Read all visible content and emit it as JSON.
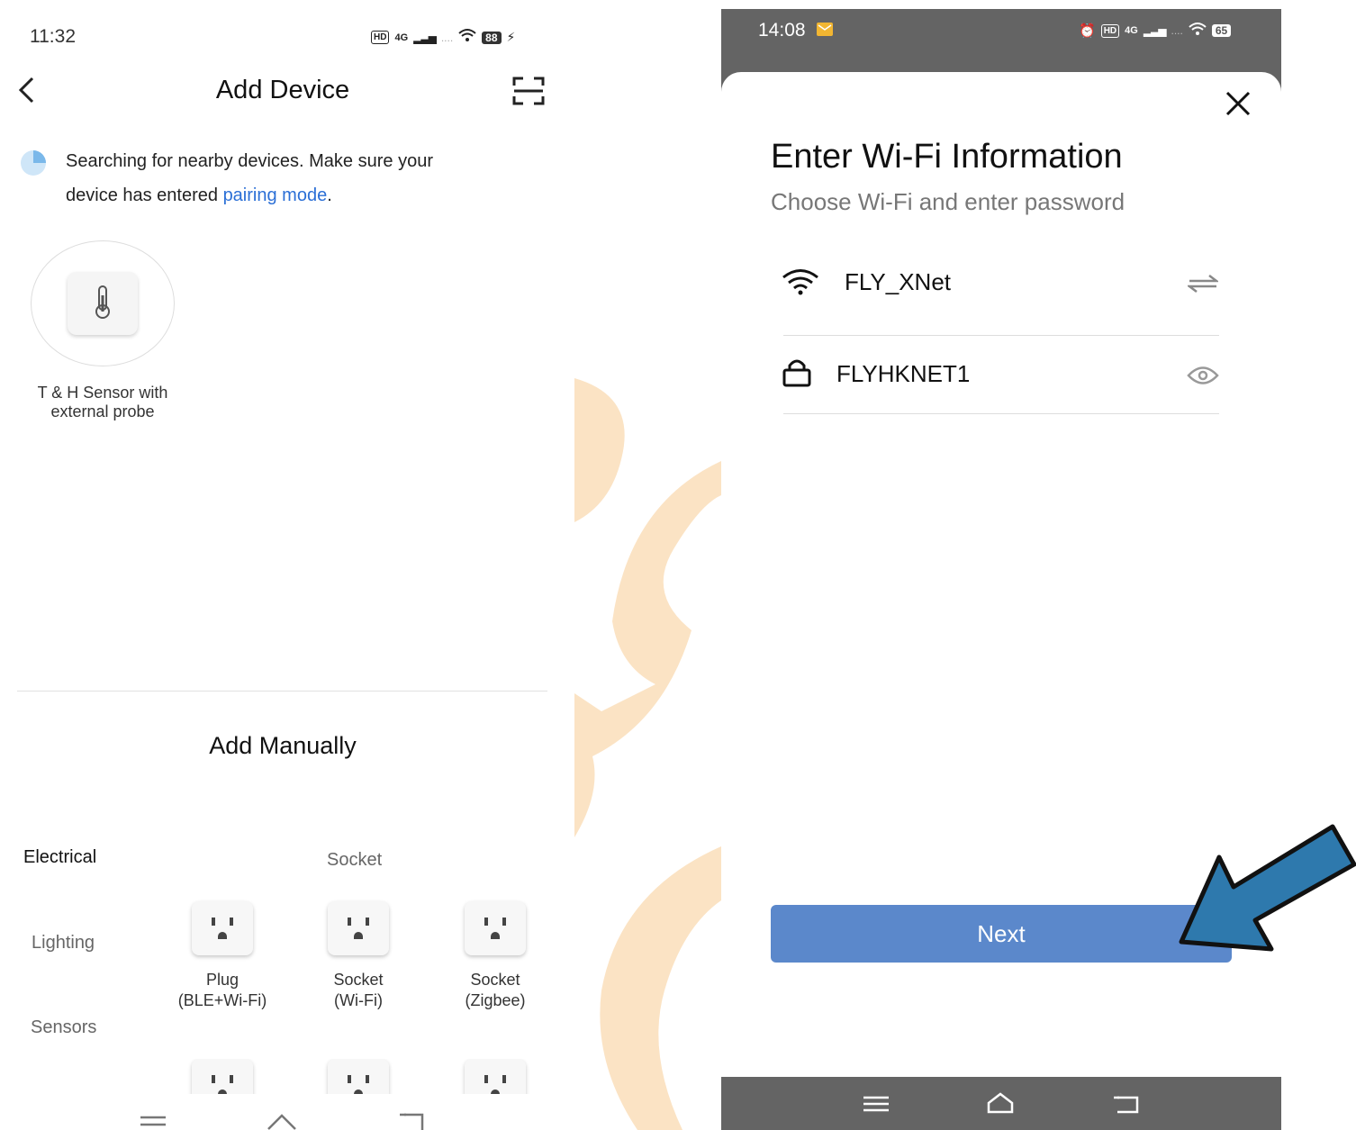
{
  "left": {
    "status": {
      "time": "11:32",
      "hd": "HD",
      "network": "4G",
      "battery": "88"
    },
    "header": {
      "title": "Add Device"
    },
    "search": {
      "text": "Searching for nearby devices. Make sure your",
      "text2": "device has entered ",
      "link": "pairing mode",
      "suffix": "."
    },
    "found_device": {
      "label_line1": "T & H Sensor with",
      "label_line2": "external probe"
    },
    "manual": {
      "title": "Add Manually",
      "categories": [
        "Electrical",
        "Lighting",
        "Sensors"
      ],
      "group_title": "Socket",
      "devices": [
        {
          "line1": "Plug",
          "line2": "(BLE+Wi-Fi)"
        },
        {
          "line1": "Socket",
          "line2": "(Wi-Fi)"
        },
        {
          "line1": "Socket",
          "line2": "(Zigbee)"
        }
      ]
    }
  },
  "right": {
    "status": {
      "time": "14:08",
      "hd": "HD",
      "network": "4G",
      "battery": "65"
    },
    "title": "Enter Wi-Fi Information",
    "subtitle": "Choose Wi-Fi and enter password",
    "ssid": "FLY_XNet",
    "password": "FLYHKNET1",
    "next_label": "Next"
  },
  "colors": {
    "link": "#2b6fd6",
    "next_button": "#5b88cb",
    "arrow": "#2e79ad",
    "watermark": "#fbe3c4"
  }
}
